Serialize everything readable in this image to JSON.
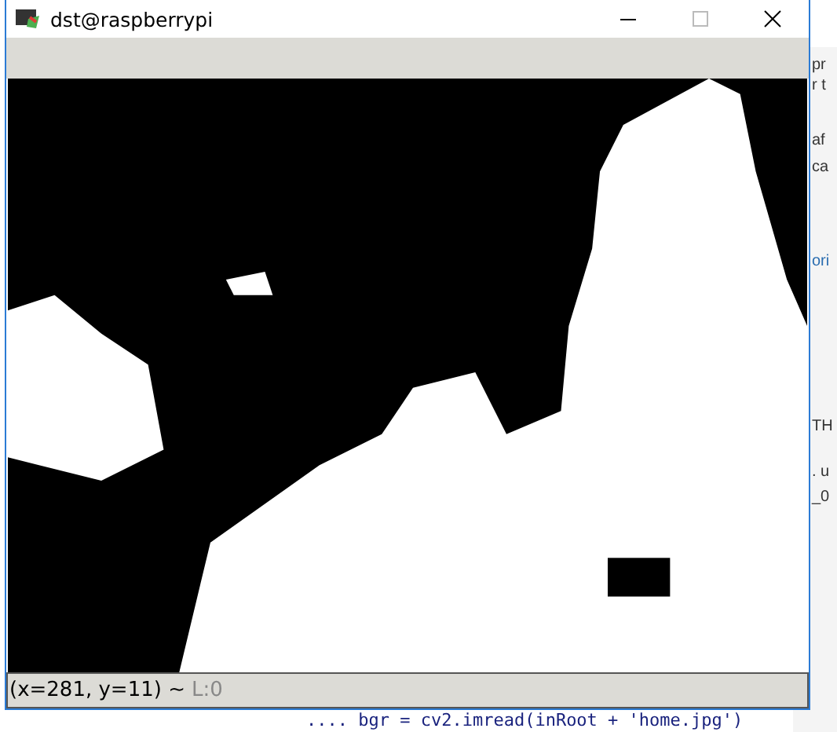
{
  "window": {
    "title": "dst@raspberrypi"
  },
  "status_bar": {
    "coords": "(x=281, y=11) ~",
    "line": "L:0"
  },
  "background": {
    "fragments": [
      "pr",
      "r t",
      "af",
      "ca",
      "ori",
      "TH",
      ". u",
      "_0"
    ],
    "code_line": ".... bgr = cv2.imread(inRoot + 'home.jpg')"
  }
}
